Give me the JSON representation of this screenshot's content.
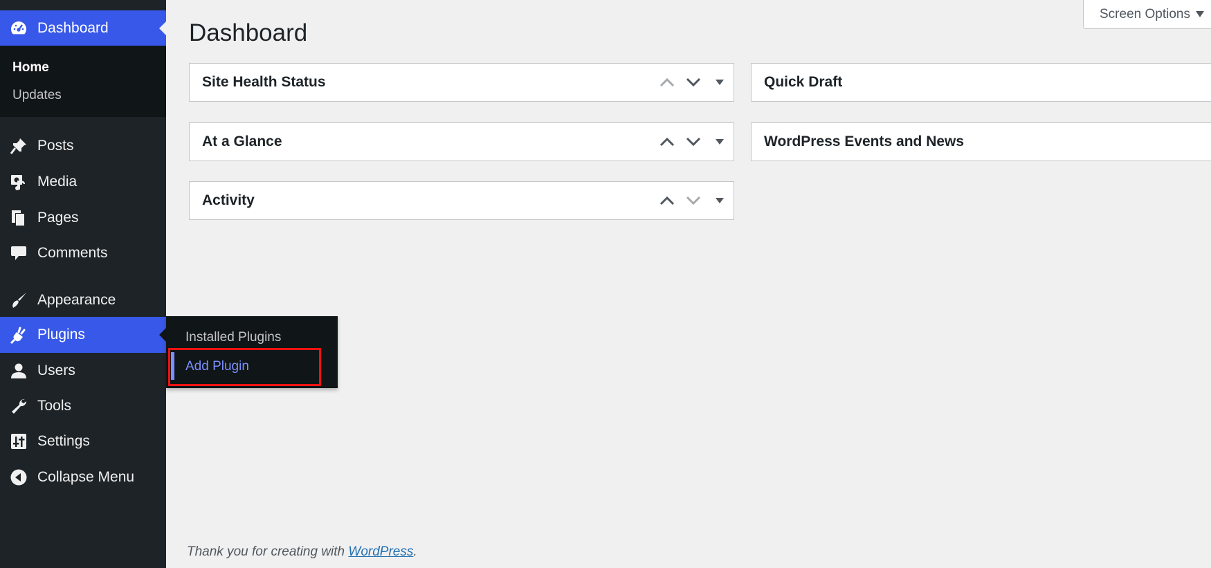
{
  "sidebar": {
    "dashboard": {
      "label": "Dashboard",
      "icon": "dashboard-icon"
    },
    "submenu": {
      "home": "Home",
      "updates": "Updates"
    },
    "items": [
      {
        "label": "Posts",
        "icon": "pin-icon"
      },
      {
        "label": "Media",
        "icon": "media-icon"
      },
      {
        "label": "Pages",
        "icon": "pages-icon"
      },
      {
        "label": "Comments",
        "icon": "comment-icon"
      },
      {
        "label": "Appearance",
        "icon": "brush-icon"
      },
      {
        "label": "Plugins",
        "icon": "plugin-icon"
      },
      {
        "label": "Users",
        "icon": "user-icon"
      },
      {
        "label": "Tools",
        "icon": "wrench-icon"
      },
      {
        "label": "Settings",
        "icon": "settings-icon"
      },
      {
        "label": "Collapse Menu",
        "icon": "collapse-icon"
      }
    ]
  },
  "flyout": {
    "installed_plugins": "Installed Plugins",
    "add_plugin": "Add Plugin"
  },
  "header": {
    "title": "Dashboard",
    "screen_options": "Screen Options"
  },
  "widgets": {
    "left": [
      "Site Health Status",
      "At a Glance",
      "Activity"
    ],
    "right": [
      "Quick Draft",
      "WordPress Events and News"
    ]
  },
  "footer": {
    "text": "Thank you for creating with ",
    "link": "WordPress",
    "period": "."
  },
  "colors": {
    "sidebar_bg": "#1d2327",
    "accent": "#3858e9",
    "flyout_link": "#7b90ff",
    "highlight": "#ee1111",
    "page_bg": "#f0f0f1"
  }
}
